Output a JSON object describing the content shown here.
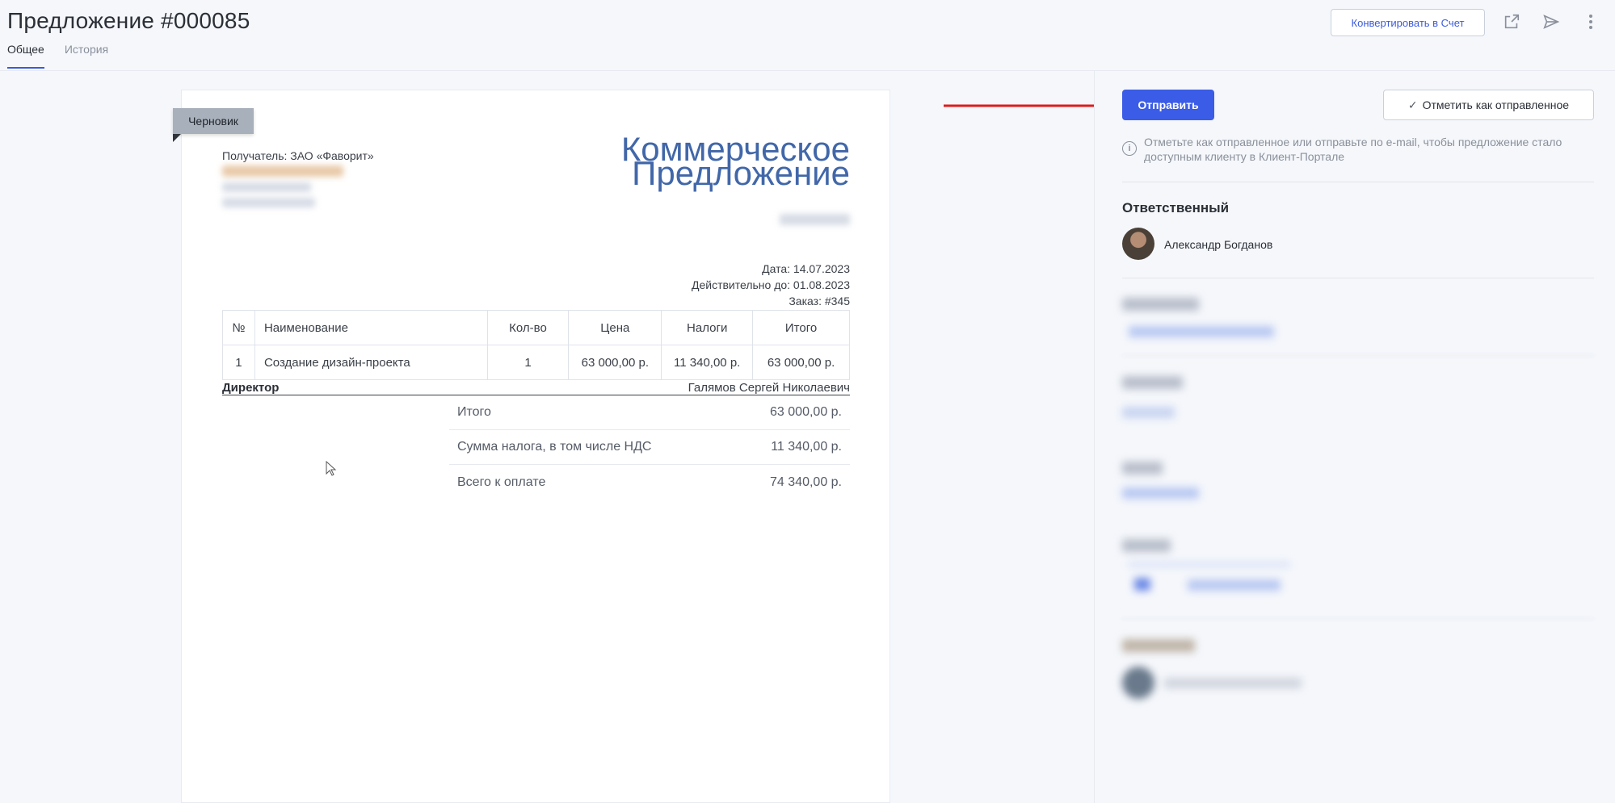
{
  "header": {
    "title": "Предложение #000085",
    "tabs": [
      {
        "label": "Общее",
        "active": true
      },
      {
        "label": "История",
        "active": false
      }
    ],
    "convert_label": "Конвертировать в Счет",
    "icons": [
      "external-link-icon",
      "send-icon",
      "more-vertical-icon"
    ]
  },
  "document": {
    "status_badge": "Черновик",
    "recipient": "Получатель: ЗАО «Фаворит»",
    "title_line1": "Коммерческое",
    "title_line2": "Предложение",
    "meta": {
      "date": "Дата: 14.07.2023",
      "valid_until": "Действительно до: 01.08.2023",
      "order": "Заказ: #345"
    },
    "table": {
      "headers": [
        "№",
        "Наименование",
        "Кол-во",
        "Цена",
        "Налоги",
        "Итого"
      ],
      "rows": [
        [
          "1",
          "Создание дизайн-проекта",
          "1",
          "63 000,00 р.",
          "11 340,00 р.",
          "63 000,00 р."
        ]
      ]
    },
    "signature": {
      "role": "Директор",
      "name": "Галямов Сергей Николаевич"
    },
    "totals": [
      {
        "label": "Итого",
        "value": "63 000,00 р."
      },
      {
        "label": "Сумма налога, в том числе НДС",
        "value": "11 340,00 р."
      },
      {
        "label": "Всего к оплате",
        "value": "74 340,00 р."
      }
    ]
  },
  "panel": {
    "send_label": "Отправить",
    "mark_sent_label": "Отметить как отправленное",
    "info_text": "Отметьте как отправленное или отправьте по e-mail, чтобы предложение стало доступным клиенту в Клиент-Портале",
    "responsible_label": "Ответственный",
    "responsible_name": "Александр Богданов"
  },
  "colors": {
    "accent": "#3b5ce6",
    "title_blue": "#4167a9",
    "arrow_red": "#e01b1b"
  }
}
